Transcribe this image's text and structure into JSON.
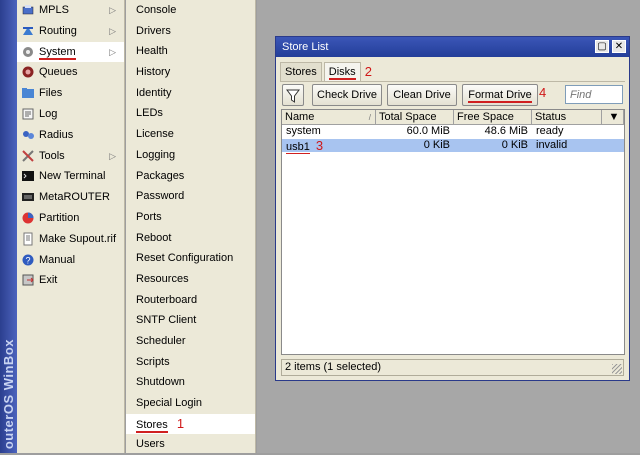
{
  "brand": {
    "text": "outerOS WinBox"
  },
  "main_menu": {
    "items": [
      {
        "label": "MPLS",
        "icon": "mpls-icon",
        "arrow": true
      },
      {
        "label": "Routing",
        "icon": "routing-icon",
        "arrow": true
      },
      {
        "label": "System",
        "icon": "gear-icon",
        "arrow": true,
        "selected": true
      },
      {
        "label": "Queues",
        "icon": "queues-icon",
        "arrow": false
      },
      {
        "label": "Files",
        "icon": "folder-icon",
        "arrow": false
      },
      {
        "label": "Log",
        "icon": "log-icon",
        "arrow": false
      },
      {
        "label": "Radius",
        "icon": "radius-icon",
        "arrow": false
      },
      {
        "label": "Tools",
        "icon": "tools-icon",
        "arrow": true
      },
      {
        "label": "New Terminal",
        "icon": "terminal-icon",
        "arrow": false
      },
      {
        "label": "MetaROUTER",
        "icon": "metarouter-icon",
        "arrow": false
      },
      {
        "label": "Partition",
        "icon": "partition-icon",
        "arrow": false
      },
      {
        "label": "Make Supout.rif",
        "icon": "supout-icon",
        "arrow": false
      },
      {
        "label": "Manual",
        "icon": "help-icon",
        "arrow": false
      },
      {
        "label": "Exit",
        "icon": "exit-icon",
        "arrow": false
      }
    ]
  },
  "sub_menu": {
    "items": [
      {
        "label": "Console"
      },
      {
        "label": "Drivers"
      },
      {
        "label": "Health"
      },
      {
        "label": "History"
      },
      {
        "label": "Identity"
      },
      {
        "label": "LEDs"
      },
      {
        "label": "License"
      },
      {
        "label": "Logging"
      },
      {
        "label": "Packages"
      },
      {
        "label": "Password"
      },
      {
        "label": "Ports"
      },
      {
        "label": "Reboot"
      },
      {
        "label": "Reset Configuration"
      },
      {
        "label": "Resources"
      },
      {
        "label": "Routerboard"
      },
      {
        "label": "SNTP Client"
      },
      {
        "label": "Scheduler"
      },
      {
        "label": "Scripts"
      },
      {
        "label": "Shutdown"
      },
      {
        "label": "Special Login"
      },
      {
        "label": "Stores",
        "selected": true,
        "annotation": "1"
      },
      {
        "label": "Users"
      }
    ]
  },
  "window": {
    "title": "Store List",
    "tabs": [
      {
        "label": "Stores"
      },
      {
        "label": "Disks",
        "active": true,
        "annotation": "2"
      }
    ],
    "toolbar": {
      "check_drive": "Check Drive",
      "clean_drive": "Clean Drive",
      "format_drive": "Format Drive",
      "format_annotation": "4",
      "find_placeholder": "Find"
    },
    "columns": [
      "Name",
      "Total Space",
      "Free Space",
      "Status"
    ],
    "rows": [
      {
        "name": "system",
        "total": "60.0 MiB",
        "free": "48.6 MiB",
        "status": "ready"
      },
      {
        "name": "usb1",
        "total": "0 KiB",
        "free": "0 KiB",
        "status": "invalid",
        "selected": true,
        "annotation": "3"
      }
    ],
    "status": "2 items (1 selected)"
  },
  "colors": {
    "brand_strip": "#2b3f8f",
    "titlebar": "#233e99",
    "selection": "#a8c4f0",
    "annotation": "#d01818"
  }
}
